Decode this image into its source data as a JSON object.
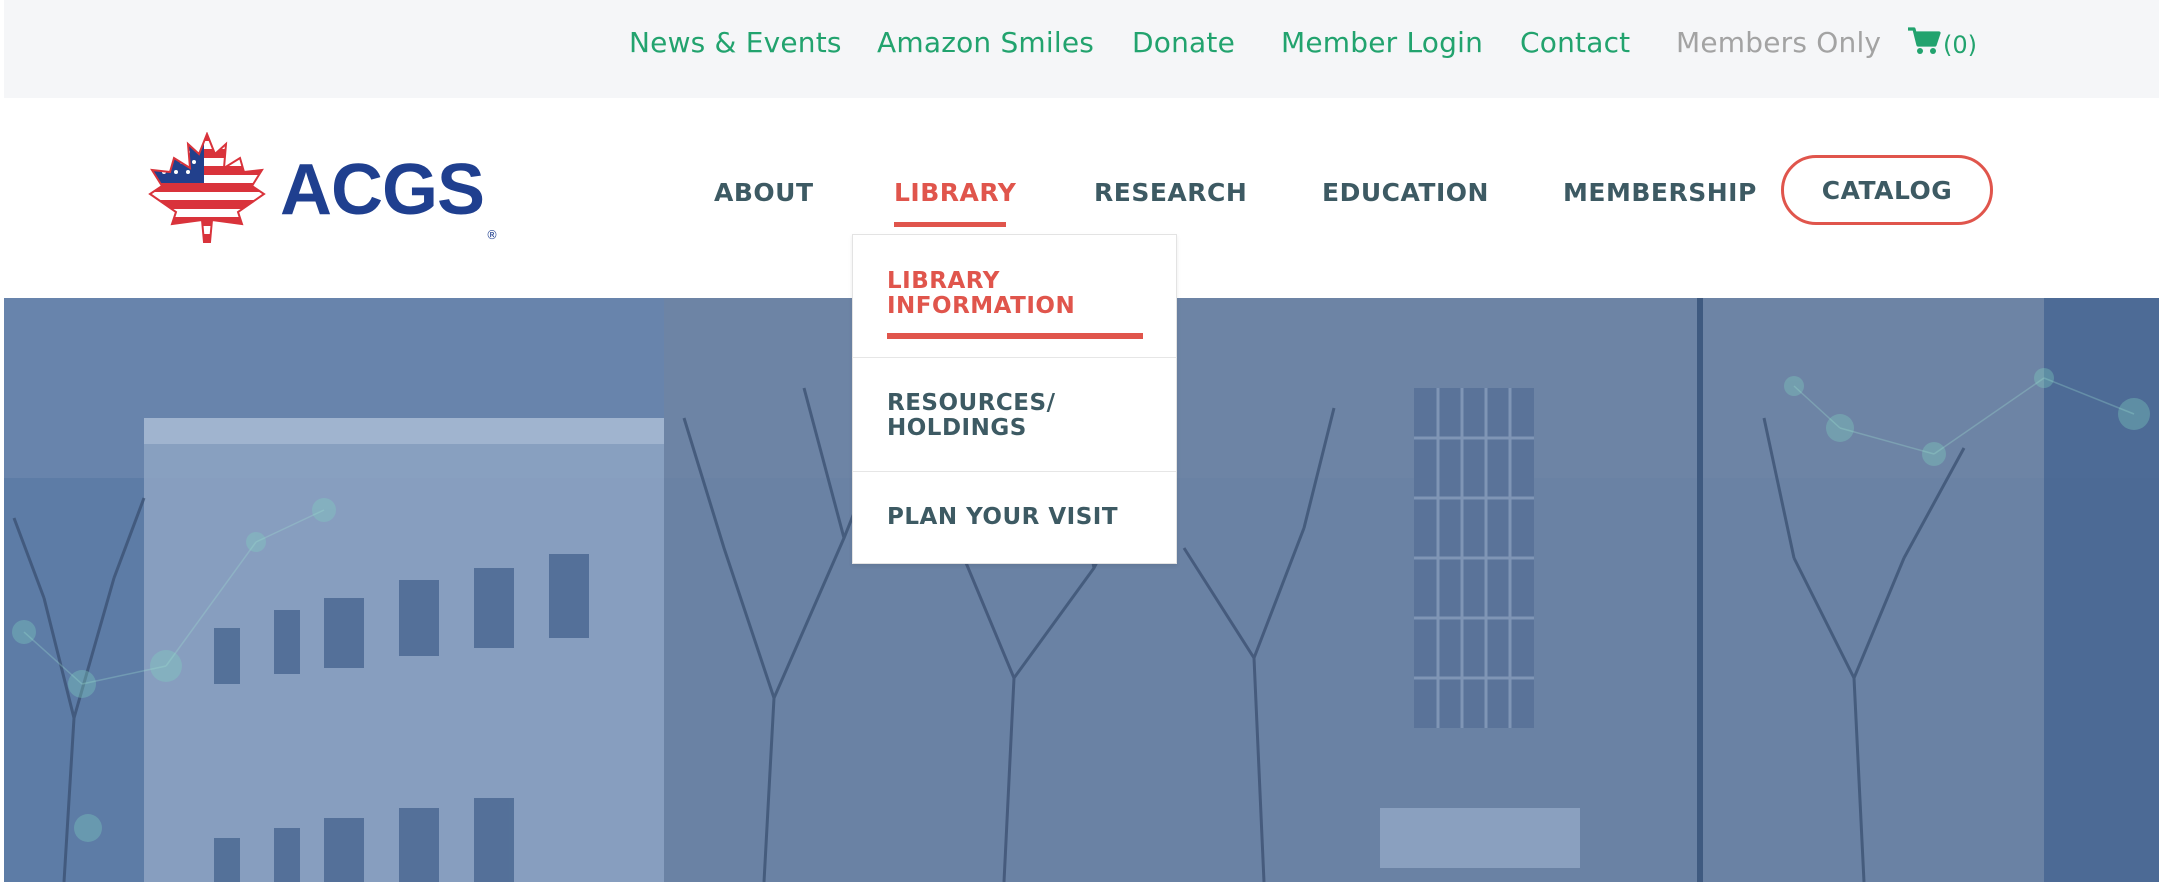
{
  "top_links": [
    {
      "label": "News & Events"
    },
    {
      "label": "Amazon Smiles"
    },
    {
      "label": "Donate"
    },
    {
      "label": "Member Login"
    },
    {
      "label": "Contact"
    },
    {
      "label": "Members Only"
    }
  ],
  "cart": {
    "count_label": "(0)",
    "icon": "cart-icon"
  },
  "logo": {
    "text": "ACGS",
    "reg_mark": "®",
    "icon": "flag-maple-leaf-logo"
  },
  "main_nav": [
    {
      "label": "ABOUT"
    },
    {
      "label": "LIBRARY"
    },
    {
      "label": "RESEARCH"
    },
    {
      "label": "EDUCATION"
    },
    {
      "label": "MEMBERSHIP"
    }
  ],
  "catalog_button": {
    "label": "CATALOG"
  },
  "library_dropdown": [
    {
      "label": "LIBRARY\nINFORMATION"
    },
    {
      "label": "RESOURCES/\nHOLDINGS"
    },
    {
      "label": "PLAN YOUR VISIT"
    }
  ],
  "colors": {
    "accent": "#e0554c",
    "link_green": "#22a36e",
    "nav_text": "#3d5a63",
    "logo_blue": "#1f3f8f",
    "hero_tint": "#5f7ea5"
  }
}
